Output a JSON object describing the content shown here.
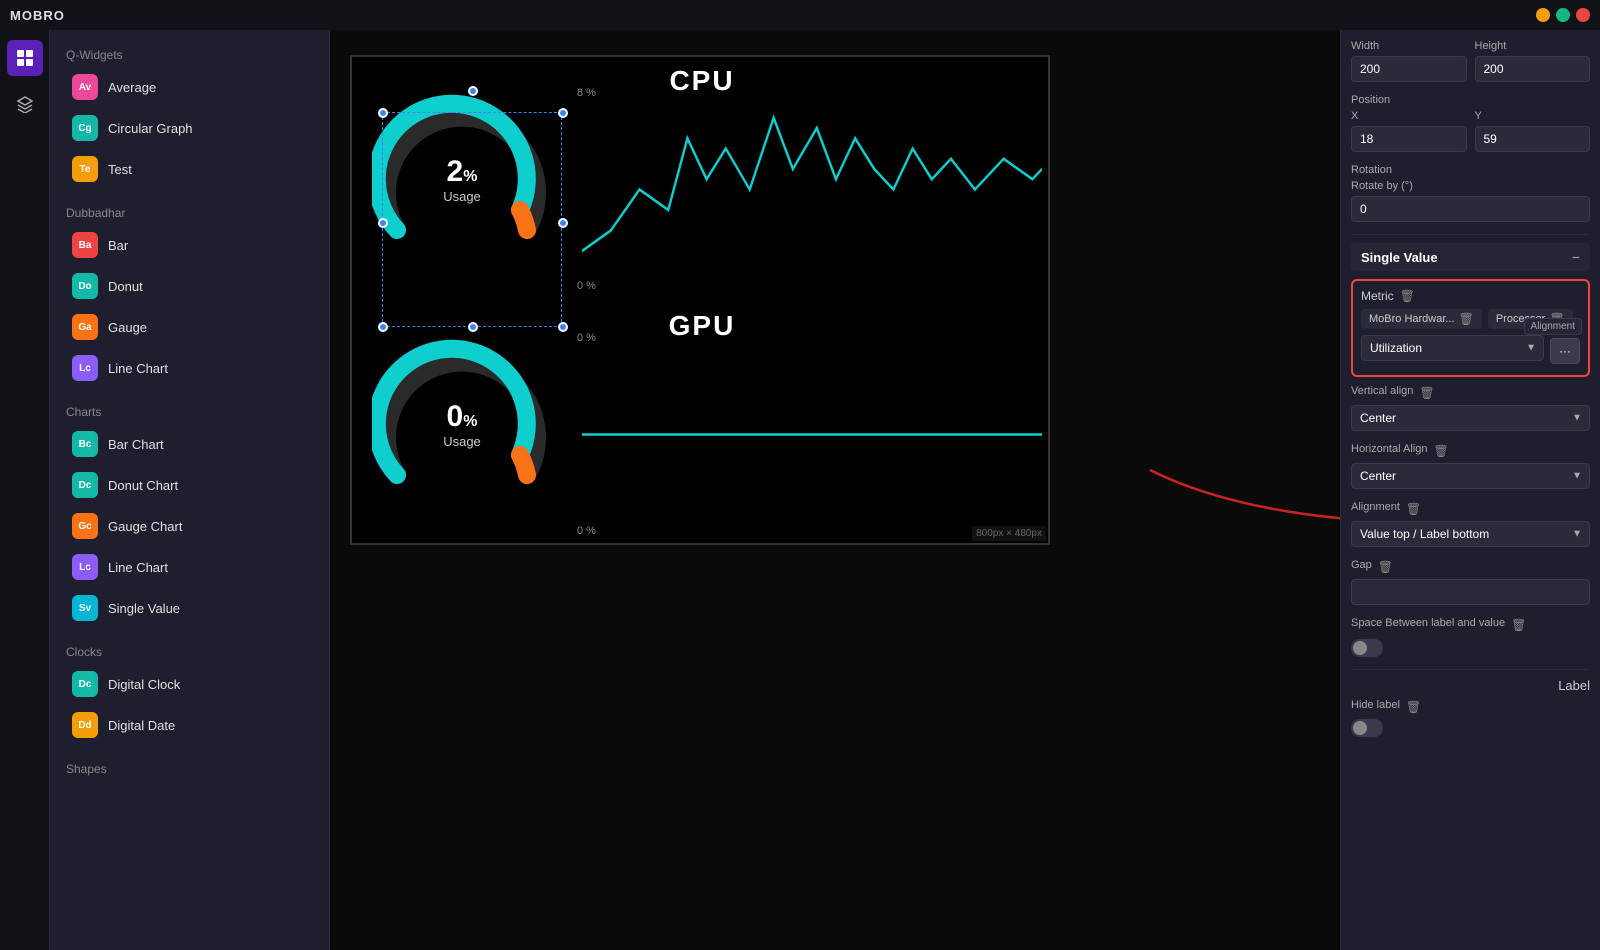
{
  "app": {
    "title": "MOBRO",
    "window_controls": [
      "minimize",
      "maximize",
      "close"
    ]
  },
  "icon_sidebar": {
    "items": [
      {
        "id": "grid",
        "icon": "⊞",
        "active": true
      },
      {
        "id": "layers",
        "icon": "◫",
        "active": false
      }
    ]
  },
  "widget_sidebar": {
    "sections": [
      {
        "title": "Q-Widgets",
        "items": [
          {
            "badge": "Av",
            "badgeColor": "badge-pink",
            "label": "Average"
          },
          {
            "badge": "Cg",
            "badgeColor": "badge-teal",
            "label": "Circular Graph"
          },
          {
            "badge": "Te",
            "badgeColor": "badge-yellow",
            "label": "Test"
          }
        ]
      },
      {
        "title": "Dubbadhar",
        "items": [
          {
            "badge": "Ba",
            "badgeColor": "badge-red",
            "label": "Bar"
          },
          {
            "badge": "Do",
            "badgeColor": "badge-teal",
            "label": "Donut"
          },
          {
            "badge": "Ga",
            "badgeColor": "badge-orange",
            "label": "Gauge"
          },
          {
            "badge": "Lc",
            "badgeColor": "badge-purple",
            "label": "Line Chart"
          }
        ]
      },
      {
        "title": "Charts",
        "items": [
          {
            "badge": "Bc",
            "badgeColor": "badge-teal",
            "label": "Bar Chart"
          },
          {
            "badge": "Dc",
            "badgeColor": "badge-teal",
            "label": "Donut Chart"
          },
          {
            "badge": "Gc",
            "badgeColor": "badge-orange",
            "label": "Gauge Chart"
          },
          {
            "badge": "Lc",
            "badgeColor": "badge-purple",
            "label": "Line Chart"
          },
          {
            "badge": "Sv",
            "badgeColor": "badge-cyan",
            "label": "Single Value"
          }
        ]
      },
      {
        "title": "Clocks",
        "items": [
          {
            "badge": "Dc",
            "badgeColor": "badge-teal",
            "label": "Digital Clock"
          },
          {
            "badge": "Dd",
            "badgeColor": "badge-yellow",
            "label": "Digital Date"
          }
        ]
      },
      {
        "title": "Shapes",
        "items": []
      }
    ]
  },
  "canvas": {
    "size_label": "800px × 480px",
    "cpu_title": "CPU",
    "gpu_title": "GPU",
    "cpu_value": "2",
    "cpu_sup": "%",
    "cpu_label": "Usage",
    "gpu_value": "0",
    "gpu_sup": "%",
    "gpu_label": "Usage",
    "chart_y_top_cpu": "8 %",
    "chart_y_bot_cpu": "0 %",
    "chart_y_top_gpu": "0 %",
    "chart_y_bot_gpu": "0 %"
  },
  "right_panel": {
    "width_label": "Width",
    "height_label": "Height",
    "width_value": "200",
    "height_value": "200",
    "position_label": "Position",
    "x_label": "X",
    "y_label": "Y",
    "x_value": "18",
    "y_value": "59",
    "rotation_label": "Rotation",
    "rotate_label": "Rotate by (°)",
    "rotate_value": "0",
    "single_value_title": "Single Value",
    "metric_label": "Metric",
    "metric_tag1": "MoBro Hardwar...",
    "metric_tag2": "Processor",
    "utilization_label": "Utilization",
    "three_dots": "···",
    "alignment_label": "Alignment",
    "vertical_align_label": "Vertical align",
    "vertical_align_value": "Center",
    "horizontal_align_label": "Horizontal Align",
    "horizontal_align_value": "Center",
    "alignment_label2": "Alignment",
    "alignment_value": "Value top / Label bottom",
    "gap_label": "Gap",
    "space_between_label": "Space Between label and value",
    "label_section": "Label",
    "hide_label": "Hide label"
  }
}
